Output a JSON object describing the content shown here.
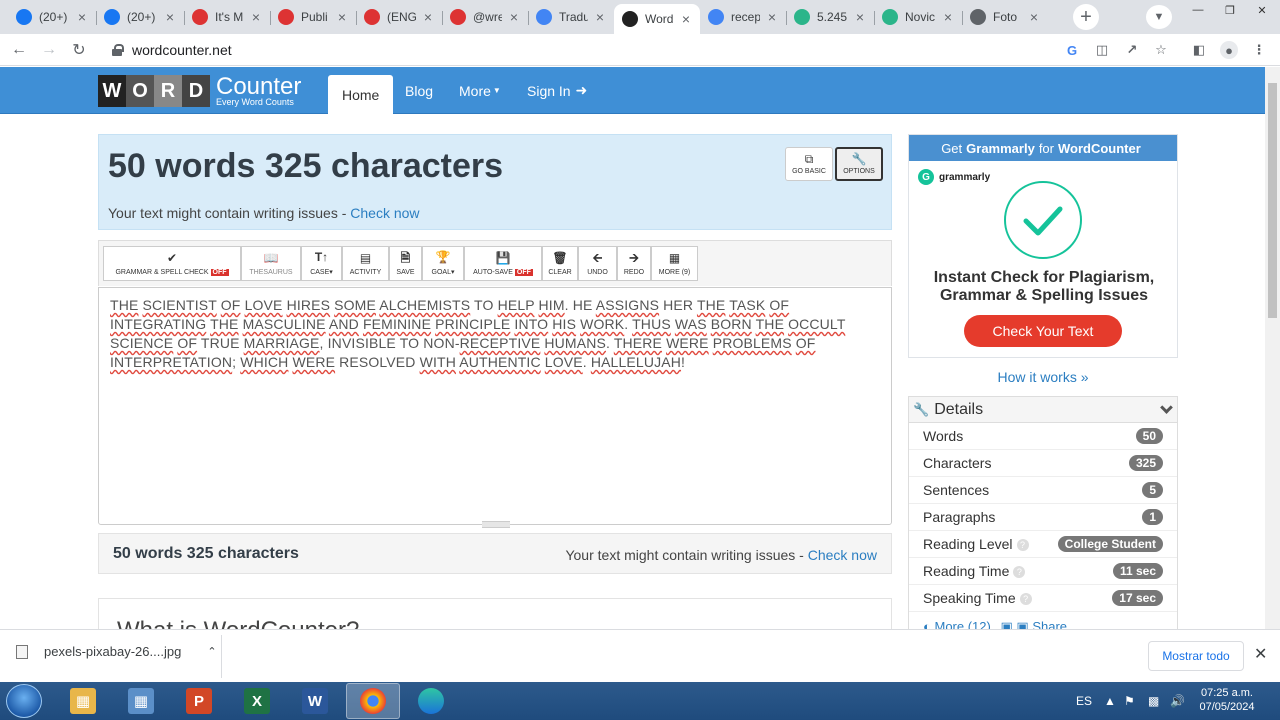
{
  "browser": {
    "tabs": [
      {
        "title": "(20+)",
        "favicon": "facebook-icon",
        "color": "#1877f2"
      },
      {
        "title": "(20+)",
        "favicon": "facebook-icon",
        "color": "#1877f2"
      },
      {
        "title": "It's M",
        "favicon": "arrow-logo-icon",
        "color": "#d33"
      },
      {
        "title": "Publi",
        "favicon": "arrow-logo-icon",
        "color": "#d33"
      },
      {
        "title": "(ENG",
        "favicon": "arrow-logo-icon",
        "color": "#d33"
      },
      {
        "title": "@wre",
        "favicon": "arrow-logo-icon",
        "color": "#d33"
      },
      {
        "title": "Tradu",
        "favicon": "translate-icon",
        "color": "#4285f4"
      },
      {
        "title": "Word",
        "favicon": "wordcounter-icon",
        "color": "#222"
      },
      {
        "title": "recep",
        "favicon": "google-icon",
        "color": "#4285f4"
      },
      {
        "title": "5.245",
        "favicon": "d-icon",
        "color": "#2bb58a"
      },
      {
        "title": "Novic",
        "favicon": "d-icon",
        "color": "#2bb58a"
      },
      {
        "title": "Foto",
        "favicon": "globe-icon",
        "color": "#5f6368"
      }
    ],
    "url": "wordcounter.net"
  },
  "site": {
    "logo_letters": [
      "W",
      "O",
      "R",
      "D"
    ],
    "logo_big": "Counter",
    "logo_small": "Every Word Counts",
    "nav": {
      "home": "Home",
      "blog": "Blog",
      "more": "More",
      "signin": "Sign In"
    }
  },
  "counter": {
    "headline": "50 words 325 characters",
    "issues_text": "Your text might contain writing issues - ",
    "check_now": "Check now",
    "go_basic": "GO BASIC",
    "options": "OPTIONS"
  },
  "toolbar": {
    "grammar": "GRAMMAR & SPELL CHECK",
    "off": "OFF",
    "thesaurus": "THESAURUS",
    "case": "CASE",
    "activity": "ACTIVITY",
    "save": "SAVE",
    "goal": "GOAL",
    "autosave": "AUTO-SAVE",
    "clear": "CLEAR",
    "undo": "UNDO",
    "redo": "REDO",
    "more": "MORE (9)"
  },
  "editor": {
    "words": [
      {
        "t": "THE",
        "e": true
      },
      {
        "t": "SCIENTIST",
        "e": true
      },
      {
        "t": "OF",
        "e": true
      },
      {
        "t": "LOVE",
        "e": true
      },
      {
        "t": "HIRES",
        "e": true
      },
      {
        "t": "SOME",
        "e": true
      },
      {
        "t": "ALCHEMISTS",
        "e": true
      },
      {
        "t": "TO",
        "e": false
      },
      {
        "t": "HELP",
        "e": true
      },
      {
        "t": "HIM",
        "e": true
      },
      {
        "t": ".",
        "e": false,
        "p": true
      },
      {
        "t": "HE",
        "e": false
      },
      {
        "t": "ASSIGNS",
        "e": true
      },
      {
        "t": "HER",
        "e": false
      },
      {
        "t": "THE",
        "e": true
      },
      {
        "t": "TASK",
        "e": true
      },
      {
        "t": "OF",
        "e": true
      },
      {
        "t": "INTEGRATING",
        "e": true
      },
      {
        "t": "THE",
        "e": true
      },
      {
        "t": "MASCULINE",
        "e": true
      },
      {
        "t": "AND",
        "e": true
      },
      {
        "t": "FEMININE",
        "e": true
      },
      {
        "t": "PRINCIPLE",
        "e": true
      },
      {
        "t": "INTO",
        "e": true
      },
      {
        "t": "HIS",
        "e": true
      },
      {
        "t": "WORK",
        "e": true
      },
      {
        "t": ".",
        "e": false,
        "p": true
      },
      {
        "t": "THUS",
        "e": true
      },
      {
        "t": "WAS",
        "e": true
      },
      {
        "t": "BORN",
        "e": true
      },
      {
        "t": "THE",
        "e": true
      },
      {
        "t": "OCCULT",
        "e": true
      },
      {
        "t": "SCIENCE",
        "e": true
      },
      {
        "t": "OF",
        "e": true
      },
      {
        "t": "TRUE",
        "e": false
      },
      {
        "t": "MARRIAGE",
        "e": true
      },
      {
        "t": ",",
        "e": false,
        "p": true
      },
      {
        "t": "INVISIBLE",
        "e": false
      },
      {
        "t": "TO",
        "e": false
      },
      {
        "t": "NON-",
        "e": false
      },
      {
        "t": "RECEPTIVE",
        "e": true,
        "j": true
      },
      {
        "t": "HUMANS",
        "e": true
      },
      {
        "t": ".",
        "e": false,
        "p": true
      },
      {
        "t": "THERE",
        "e": true
      },
      {
        "t": "WERE",
        "e": true
      },
      {
        "t": "PROBLEMS",
        "e": true
      },
      {
        "t": "OF",
        "e": true
      },
      {
        "t": "INTERPRETATION",
        "e": true
      },
      {
        "t": ";",
        "e": false,
        "p": true
      },
      {
        "t": "WHICH",
        "e": true
      },
      {
        "t": "WERE",
        "e": true
      },
      {
        "t": "RESOLVED",
        "e": false
      },
      {
        "t": "WITH",
        "e": true
      },
      {
        "t": "AUTHENTIC",
        "e": true
      },
      {
        "t": "LOVE",
        "e": true
      },
      {
        "t": ".",
        "e": false,
        "p": true
      },
      {
        "t": "HALLELUJAH",
        "e": true
      },
      {
        "t": "!",
        "e": false,
        "p": true
      }
    ]
  },
  "footer": {
    "count": "50 words 325 characters",
    "issues_text": "Your text might contain writing issues - ",
    "check_now": "Check now"
  },
  "what": {
    "title": "What is WordCounter?"
  },
  "ad": {
    "head_pre": "Get",
    "head_brand": "Grammarly",
    "head_mid": "for",
    "head_site": "WordCounter",
    "brand": "grammarly",
    "tagline_1": "Instant Check for Plagiarism,",
    "tagline_2": "Grammar & Spelling Issues",
    "cta": "Check Your Text",
    "how": "How it works »"
  },
  "details": {
    "title": "Details",
    "rows": [
      {
        "label": "Words",
        "value": "50",
        "help": false
      },
      {
        "label": "Characters",
        "value": "325",
        "help": false
      },
      {
        "label": "Sentences",
        "value": "5",
        "help": false
      },
      {
        "label": "Paragraphs",
        "value": "1",
        "help": false
      },
      {
        "label": "Reading Level",
        "value": "College Student",
        "help": true
      },
      {
        "label": "Reading Time",
        "value": "11 sec",
        "help": true
      },
      {
        "label": "Speaking Time",
        "value": "17 sec",
        "help": true
      }
    ],
    "more": "More (12)",
    "share": "Share"
  },
  "download": {
    "file": "pexels-pixabay-26....jpg",
    "show_all": "Mostrar todo"
  },
  "taskbar": {
    "lang": "ES",
    "time": "07:25 a.m.",
    "date": "07/05/2024"
  }
}
